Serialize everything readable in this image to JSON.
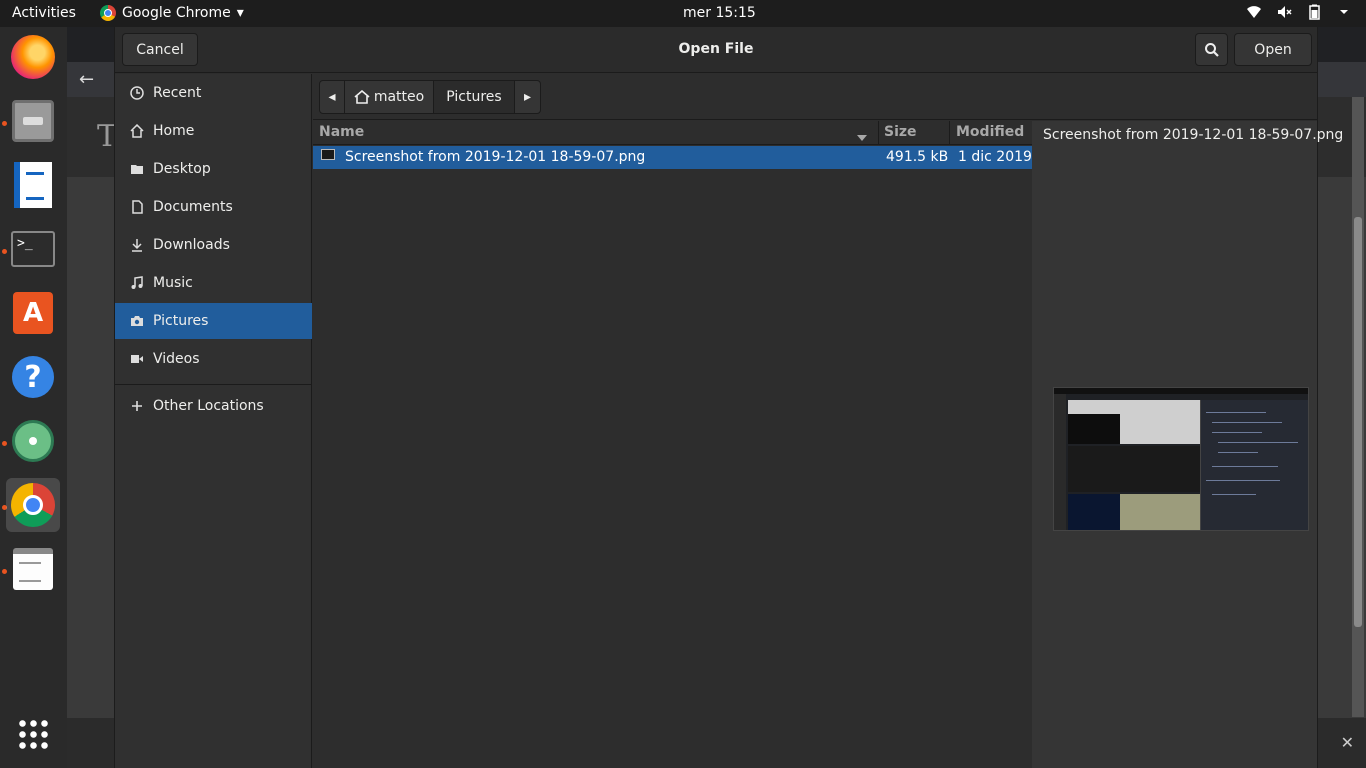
{
  "topbar": {
    "activities": "Activities",
    "app_name": "Google Chrome",
    "app_menu_arrow": "▾",
    "clock": "mer 15:15",
    "status_icons": [
      "wifi-icon",
      "volume-muted-icon",
      "battery-icon",
      "power-menu-arrow-icon"
    ]
  },
  "dock": {
    "items": [
      "firefox",
      "files",
      "libreoffice-writer",
      "terminal",
      "ubuntu-software",
      "help",
      "atom",
      "google-chrome",
      "text-editor"
    ],
    "show_apps": "app-grid-icon"
  },
  "dialog": {
    "title": "Open File",
    "cancel_label": "Cancel",
    "open_label": "Open",
    "search_icon": "search-icon"
  },
  "sidebar": {
    "items": [
      {
        "label": "Recent",
        "icon": "clock-icon"
      },
      {
        "label": "Home",
        "icon": "home-icon"
      },
      {
        "label": "Desktop",
        "icon": "folder-icon"
      },
      {
        "label": "Documents",
        "icon": "document-icon"
      },
      {
        "label": "Downloads",
        "icon": "download-icon"
      },
      {
        "label": "Music",
        "icon": "music-icon"
      },
      {
        "label": "Pictures",
        "icon": "camera-icon"
      },
      {
        "label": "Videos",
        "icon": "video-icon"
      }
    ],
    "other_locations": "Other Locations",
    "other_icon": "plus-icon",
    "selected": "Pictures"
  },
  "pathbar": {
    "crumbs": [
      "matteo",
      "Pictures"
    ],
    "left_arrow": "◂",
    "right_arrow": "▸"
  },
  "filelist": {
    "headers": {
      "name": "Name",
      "size": "Size",
      "modified": "Modified"
    },
    "rows": [
      {
        "name": "Screenshot from 2019-12-01 18-59-07.png",
        "size": "491.5 kB",
        "modified": "1 dic 2019",
        "selected": true
      }
    ]
  },
  "preview": {
    "filename": "Screenshot from 2019-12-01 18-59-07.png"
  },
  "colors": {
    "selection": "#215d9c",
    "topbar": "#1d1d1d",
    "dialog_bg": "#2d2d2d",
    "accent_dot": "#e95420"
  }
}
